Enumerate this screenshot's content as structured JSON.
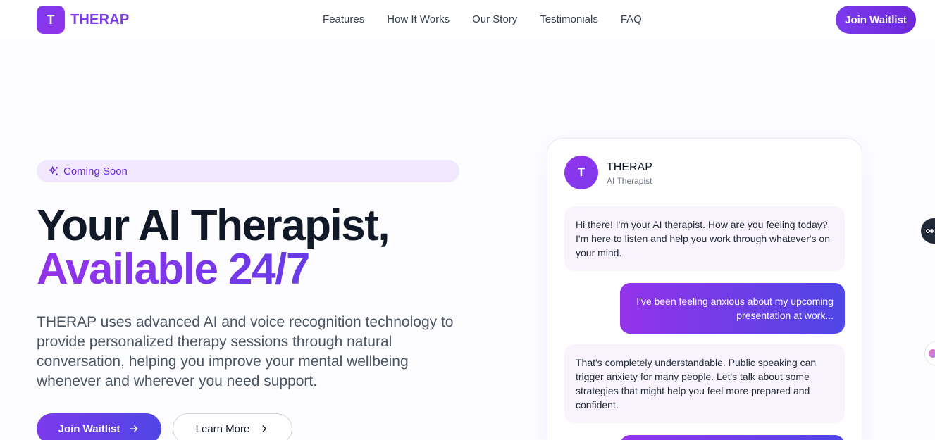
{
  "header": {
    "logo_letter": "T",
    "brand": "THERAP",
    "nav": [
      "Features",
      "How It Works",
      "Our Story",
      "Testimonials",
      "FAQ"
    ],
    "cta": "Join Waitlist"
  },
  "hero": {
    "badge": "Coming Soon",
    "title_line1": "Your AI Therapist,",
    "title_line2": "Available 24/7",
    "description": "THERAP uses advanced AI and voice recognition technology to provide personalized therapy sessions through natural conversation, helping you improve your mental wellbeing whenever and wherever you need support.",
    "primary_cta": "Join Waitlist",
    "secondary_cta": "Learn More"
  },
  "chat": {
    "avatar_letter": "T",
    "name": "THERAP",
    "role": "AI Therapist",
    "messages": [
      {
        "from": "ai",
        "text": "Hi there! I'm your AI therapist. How are you feeling today? I'm here to listen and help you work through whatever's on your mind."
      },
      {
        "from": "user",
        "text": "I've been feeling anxious about my upcoming presentation at work..."
      },
      {
        "from": "ai",
        "text": "That's completely understandable. Public speaking can trigger anxiety for many people. Let's talk about some strategies that might help you feel more prepared and confident."
      }
    ]
  },
  "icons": {
    "badge": "sparkles-icon",
    "primary_cta": "arrow-right-icon",
    "secondary_cta": "chevron-right-icon"
  },
  "colors": {
    "brand_purple": "#7c3aed",
    "gradient_end": "#4f46e5",
    "badge_bg": "#f1e8fd",
    "ai_bubble_bg": "#f8f3fd"
  }
}
